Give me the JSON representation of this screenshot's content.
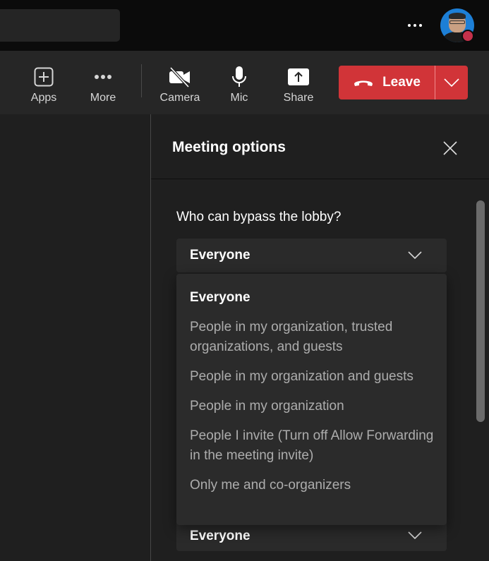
{
  "topbar": {
    "more_icon": "ellipsis-horizontal-icon",
    "avatar_status": "busy",
    "colors": {
      "status": "#c4314b",
      "avatar_bg": "#1d7fd6"
    }
  },
  "toolbar": {
    "buttons": [
      {
        "label": "Apps",
        "icon": "apps-add-icon"
      },
      {
        "label": "More",
        "icon": "more-dots-icon"
      },
      {
        "label": "Camera",
        "icon": "camera-off-icon"
      },
      {
        "label": "Mic",
        "icon": "microphone-icon"
      },
      {
        "label": "Share",
        "icon": "share-tray-icon"
      }
    ],
    "leave": {
      "label": "Leave",
      "icon": "hang-up-icon",
      "color": "#d13438"
    }
  },
  "panel": {
    "title": "Meeting options",
    "close_icon": "close-x-icon",
    "lobby_question": "Who can bypass the lobby?",
    "lobby_select_value": "Everyone",
    "lobby_options": [
      {
        "label": "Everyone",
        "selected": true
      },
      {
        "label": "People in my organization, trusted organizations, and guests",
        "selected": false
      },
      {
        "label": "People in my organization and guests",
        "selected": false
      },
      {
        "label": "People in my organization",
        "selected": false
      },
      {
        "label": "People I invite (Turn off Allow Forwarding in the meeting invite)",
        "selected": false
      },
      {
        "label": "Only me and co-organizers",
        "selected": false
      }
    ],
    "second_select_value": "Everyone"
  }
}
